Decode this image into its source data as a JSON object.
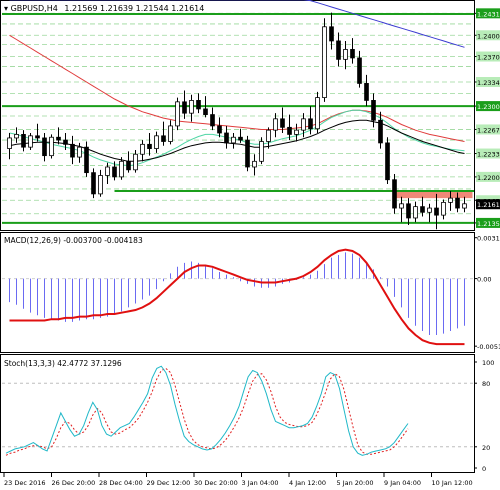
{
  "header": {
    "symbol": "GBPUSD,H4",
    "ohlc": "1.21569 1.21639 1.21544 1.21614"
  },
  "colors": {
    "grid": "#c8c8c8",
    "bull": "#000000",
    "bear": "#000000",
    "candle_fill_bull": "#ffffff",
    "ma_fast": "#4fd6a5",
    "ma_mid": "#000000",
    "ma_slow": "#e03c3c",
    "ma_trend": "#3a3ad0",
    "level_line": "#1a9e1a",
    "level_label_bg": "#7ddc7d",
    "zone_fill": "#f08878",
    "price_label_bg": "#000000",
    "macd_hist": "#6a6af2",
    "macd_signal": "#e01010",
    "stoch_main": "#20b8c8",
    "stoch_signal": "#e02020"
  },
  "chart_data": [
    {
      "panel": "price",
      "type": "candlestick",
      "ylim": [
        1.2125,
        1.2447
      ],
      "ticks": [
        "1.24310",
        "1.24000",
        "1.23700",
        "1.23340",
        "1.23000",
        "1.22670",
        "1.22330",
        "1.22000",
        "1.21670",
        "1.21350"
      ],
      "ticks_v": [
        1.2431,
        1.24,
        1.237,
        1.2334,
        1.23,
        1.2267,
        1.2233,
        1.22,
        1.2167,
        1.2135
      ],
      "hidden_ticks_v": [
        1.2416,
        1.2387,
        1.2356,
        1.2318,
        1.2286,
        1.2252,
        1.2216,
        1.2183,
        1.2148
      ],
      "levels": [
        {
          "label": "1.24300",
          "value": 1.243,
          "style": "solid"
        },
        {
          "label": "1.23000",
          "value": 1.23,
          "style": "solid"
        },
        {
          "label": "1.21800",
          "value": 1.218,
          "style": "solid"
        },
        {
          "label": "1.21350",
          "value": 1.2135,
          "style": "solid"
        }
      ],
      "current_price": {
        "label": "1.21614",
        "value": 1.21614
      },
      "zone": {
        "from": 1.217,
        "to": 1.218
      },
      "candles": [
        [
          1.224,
          1.2262,
          1.2225,
          1.2255
        ],
        [
          1.2255,
          1.227,
          1.2248,
          1.226
        ],
        [
          1.226,
          1.2266,
          1.2236,
          1.2242
        ],
        [
          1.2242,
          1.2262,
          1.2238,
          1.2258
        ],
        [
          1.2258,
          1.2275,
          1.225,
          1.2255
        ],
        [
          1.2255,
          1.2262,
          1.2222,
          1.223
        ],
        [
          1.223,
          1.226,
          1.2226,
          1.2256
        ],
        [
          1.2256,
          1.227,
          1.2246,
          1.2252
        ],
        [
          1.2252,
          1.2262,
          1.2238,
          1.2246
        ],
        [
          1.2246,
          1.2258,
          1.2218,
          1.2228
        ],
        [
          1.2228,
          1.2248,
          1.222,
          1.2242
        ],
        [
          1.2242,
          1.225,
          1.22,
          1.2206
        ],
        [
          1.2206,
          1.2212,
          1.217,
          1.2176
        ],
        [
          1.2176,
          1.221,
          1.2172,
          1.2202
        ],
        [
          1.2202,
          1.222,
          1.219,
          1.2214
        ],
        [
          1.2214,
          1.2222,
          1.2195,
          1.22
        ],
        [
          1.22,
          1.2228,
          1.2196,
          1.2222
        ],
        [
          1.2222,
          1.2236,
          1.2206,
          1.221
        ],
        [
          1.221,
          1.2238,
          1.2206,
          1.2232
        ],
        [
          1.2232,
          1.2252,
          1.2222,
          1.2246
        ],
        [
          1.2246,
          1.2262,
          1.223,
          1.224
        ],
        [
          1.224,
          1.2264,
          1.2234,
          1.2258
        ],
        [
          1.2258,
          1.2278,
          1.2244,
          1.225
        ],
        [
          1.225,
          1.228,
          1.2246,
          1.2272
        ],
        [
          1.2272,
          1.2312,
          1.2266,
          1.2306
        ],
        [
          1.2306,
          1.2322,
          1.2282,
          1.229
        ],
        [
          1.229,
          1.2316,
          1.2278,
          1.2308
        ],
        [
          1.2308,
          1.2318,
          1.229,
          1.2296
        ],
        [
          1.2296,
          1.2314,
          1.2284,
          1.2288
        ],
        [
          1.2288,
          1.2298,
          1.2266,
          1.2272
        ],
        [
          1.2272,
          1.2284,
          1.2256,
          1.2262
        ],
        [
          1.2262,
          1.2272,
          1.224,
          1.2248
        ],
        [
          1.2248,
          1.2262,
          1.224,
          1.2256
        ],
        [
          1.2256,
          1.2268,
          1.2248,
          1.2252
        ],
        [
          1.2252,
          1.2258,
          1.2208,
          1.2214
        ],
        [
          1.2214,
          1.2232,
          1.2202,
          1.2222
        ],
        [
          1.2222,
          1.2256,
          1.2218,
          1.225
        ],
        [
          1.225,
          1.227,
          1.224,
          1.2266
        ],
        [
          1.2266,
          1.229,
          1.2256,
          1.2282
        ],
        [
          1.2282,
          1.2298,
          1.2262,
          1.227
        ],
        [
          1.227,
          1.2288,
          1.2252,
          1.226
        ],
        [
          1.226,
          1.2275,
          1.225,
          1.2266
        ],
        [
          1.2266,
          1.229,
          1.2256,
          1.2282
        ],
        [
          1.2282,
          1.23,
          1.226,
          1.2268
        ],
        [
          1.2268,
          1.232,
          1.2262,
          1.2312
        ],
        [
          1.2312,
          1.2424,
          1.2306,
          1.2412
        ],
        [
          1.2412,
          1.2432,
          1.238,
          1.2392
        ],
        [
          1.2392,
          1.2404,
          1.2356,
          1.2366
        ],
        [
          1.2366,
          1.2392,
          1.2352,
          1.238
        ],
        [
          1.238,
          1.2396,
          1.236,
          1.2368
        ],
        [
          1.2368,
          1.2378,
          1.2326,
          1.2332
        ],
        [
          1.2332,
          1.2344,
          1.23,
          1.2308
        ],
        [
          1.2308,
          1.2318,
          1.227,
          1.228
        ],
        [
          1.228,
          1.2292,
          1.224,
          1.2248
        ],
        [
          1.2248,
          1.2256,
          1.219,
          1.2196
        ],
        [
          1.2196,
          1.2204,
          1.2148,
          1.2156
        ],
        [
          1.2156,
          1.2172,
          1.2136,
          1.2162
        ],
        [
          1.2162,
          1.217,
          1.2132,
          1.2142
        ],
        [
          1.2142,
          1.2165,
          1.2136,
          1.2158
        ],
        [
          1.2158,
          1.2172,
          1.2144,
          1.215
        ],
        [
          1.215,
          1.2162,
          1.2136,
          1.2156
        ],
        [
          1.2156,
          1.2176,
          1.2126,
          1.2146
        ],
        [
          1.2146,
          1.2168,
          1.214,
          1.2164
        ],
        [
          1.2164,
          1.218,
          1.2152,
          1.217
        ],
        [
          1.217,
          1.2178,
          1.215,
          1.2156
        ],
        [
          1.2156,
          1.2172,
          1.215,
          1.2162
        ]
      ],
      "ma_fast": [
        1.2262,
        1.226,
        1.2257,
        1.2254,
        1.2252,
        1.2249,
        1.2246,
        1.2244,
        1.2242,
        1.224,
        1.2237,
        1.2233,
        1.2228,
        1.2224,
        1.2221,
        1.2218,
        1.2217,
        1.2216,
        1.2217,
        1.222,
        1.2224,
        1.2228,
        1.2232,
        1.2237,
        1.2242,
        1.2248,
        1.2253,
        1.2257,
        1.226,
        1.226,
        1.2258,
        1.2256,
        1.2254,
        1.2252,
        1.2248,
        1.2246,
        1.2246,
        1.2248,
        1.2251,
        1.2254,
        1.2256,
        1.2258,
        1.2262,
        1.2266,
        1.2271,
        1.2278,
        1.2284,
        1.2288,
        1.2292,
        1.2294,
        1.2294,
        1.2292,
        1.2288,
        1.2283,
        1.2276,
        1.2268,
        1.2262,
        1.2256,
        1.2252,
        1.2248,
        1.2245,
        1.2243,
        1.2241,
        1.2239,
        1.2238,
        1.2237
      ],
      "ma_mid": [
        1.2244,
        1.2246,
        1.2247,
        1.2248,
        1.2249,
        1.2249,
        1.2249,
        1.2248,
        1.2247,
        1.2245,
        1.2243,
        1.224,
        1.2236,
        1.2232,
        1.2229,
        1.2226,
        1.2224,
        1.2222,
        1.2222,
        1.2223,
        1.2225,
        1.2227,
        1.223,
        1.2233,
        1.2237,
        1.2241,
        1.2244,
        1.2246,
        1.2248,
        1.2249,
        1.2249,
        1.2248,
        1.2247,
        1.2246,
        1.2244,
        1.2242,
        1.2242,
        1.2243,
        1.2245,
        1.2247,
        1.2249,
        1.2251,
        1.2254,
        1.2257,
        1.2261,
        1.2266,
        1.227,
        1.2274,
        1.2277,
        1.2279,
        1.228,
        1.228,
        1.2278,
        1.2276,
        1.2272,
        1.2267,
        1.2262,
        1.2258,
        1.2254,
        1.225,
        1.2247,
        1.2244,
        1.2241,
        1.2238,
        1.2235,
        1.2233
      ],
      "ma_slow": [
        1.24,
        1.2394,
        1.2388,
        1.2382,
        1.2376,
        1.237,
        1.2364,
        1.2358,
        1.2352,
        1.2346,
        1.234,
        1.2334,
        1.2328,
        1.2322,
        1.2316,
        1.231,
        1.2305,
        1.23,
        1.2296,
        1.2292,
        1.2289,
        1.2286,
        1.2283,
        1.2281,
        1.2279,
        1.2278,
        1.2277,
        1.2276,
        1.2275,
        1.2274,
        1.2273,
        1.2272,
        1.2271,
        1.227,
        1.2269,
        1.2268,
        1.2267,
        1.2267,
        1.2267,
        1.2267,
        1.2268,
        1.2269,
        1.227,
        1.2272,
        1.2275,
        1.228,
        1.2285,
        1.2289,
        1.2292,
        1.2294,
        1.2294,
        1.2293,
        1.2291,
        1.2288,
        1.2284,
        1.2279,
        1.2274,
        1.227,
        1.2266,
        1.2263,
        1.226,
        1.2258,
        1.2256,
        1.2254,
        1.2252,
        1.225
      ],
      "ma_trend": [
        1.245,
        1.245,
        1.245,
        1.245,
        1.245,
        1.245,
        1.245,
        1.245,
        1.245,
        1.245,
        1.245,
        1.245,
        1.245,
        1.245,
        1.245,
        1.245,
        1.245,
        1.245,
        1.245,
        1.245,
        1.245,
        1.245,
        1.245,
        1.245,
        1.245,
        1.245,
        1.245,
        1.245,
        1.245,
        1.245,
        1.245,
        1.245,
        1.245,
        1.245,
        1.245,
        1.245,
        1.245,
        1.245,
        1.245,
        1.245,
        1.245,
        1.245,
        1.245,
        1.2449,
        1.2446,
        1.2443,
        1.244,
        1.2437,
        1.2434,
        1.2431,
        1.2428,
        1.2425,
        1.2422,
        1.2419,
        1.2416,
        1.2413,
        1.241,
        1.2407,
        1.2404,
        1.2401,
        1.2398,
        1.2395,
        1.2392,
        1.2389,
        1.2386,
        1.2383
      ]
    },
    {
      "panel": "macd",
      "type": "histogram+line",
      "title": "MACD(12,26,9) -0.003700 -0.004183",
      "ylim": [
        -0.0056,
        0.0034
      ],
      "ticks": [
        "0.003118",
        "0.00",
        "-0.005155"
      ],
      "ticks_v": [
        0.003118,
        0.0,
        -0.005155
      ],
      "hist": [
        -0.0018,
        -0.002,
        -0.0023,
        -0.0026,
        -0.0028,
        -0.003,
        -0.0031,
        -0.0032,
        -0.0033,
        -0.0033,
        -0.0032,
        -0.0031,
        -0.0031,
        -0.003,
        -0.0029,
        -0.0027,
        -0.0025,
        -0.0022,
        -0.0019,
        -0.0016,
        -0.0013,
        -0.0008,
        -0.0002,
        0.0004,
        0.0009,
        0.0012,
        0.0013,
        0.0012,
        0.001,
        0.0008,
        0.0005,
        0.0003,
        0.0001,
        -0.0002,
        -0.0004,
        -0.0006,
        -0.0007,
        -0.0007,
        -0.0006,
        -0.0004,
        -0.0003,
        -0.0001,
        0.0001,
        0.0003,
        0.0006,
        0.0011,
        0.0016,
        0.0018,
        0.002,
        0.0019,
        0.0016,
        0.0012,
        0.0007,
        0.0001,
        -0.0006,
        -0.0014,
        -0.0022,
        -0.003,
        -0.0036,
        -0.004,
        -0.0043,
        -0.0043,
        -0.0042,
        -0.004,
        -0.0038,
        -0.0036
      ],
      "signal": [
        -0.0032,
        -0.0032,
        -0.0032,
        -0.0032,
        -0.0032,
        -0.0032,
        -0.0031,
        -0.0031,
        -0.003,
        -0.003,
        -0.0029,
        -0.0029,
        -0.0028,
        -0.0028,
        -0.0027,
        -0.0027,
        -0.0026,
        -0.0025,
        -0.0024,
        -0.0022,
        -0.0019,
        -0.0015,
        -0.001,
        -0.0005,
        0.0,
        0.0005,
        0.0008,
        0.001,
        0.001,
        0.0009,
        0.0007,
        0.0005,
        0.0003,
        0.0001,
        -0.0001,
        -0.0002,
        -0.0003,
        -0.0003,
        -0.0003,
        -0.0002,
        -0.0001,
        0.0,
        0.0002,
        0.0005,
        0.0009,
        0.0014,
        0.0018,
        0.0021,
        0.0022,
        0.0021,
        0.0018,
        0.0012,
        0.0004,
        -0.0005,
        -0.0014,
        -0.0023,
        -0.0031,
        -0.0038,
        -0.0043,
        -0.0047,
        -0.0049,
        -0.005,
        -0.005,
        -0.005,
        -0.005,
        -0.005
      ]
    },
    {
      "panel": "stoch",
      "type": "line",
      "title": "Stoch(13,3,3) 42.4772 37.1296",
      "ylim": [
        0,
        100
      ],
      "ticks": [
        "100",
        "80",
        "20",
        "0"
      ],
      "ticks_v": [
        100,
        80,
        20,
        0
      ],
      "levels": [
        80,
        20
      ],
      "main": [
        14,
        16,
        18,
        19,
        20,
        22,
        24,
        21,
        18,
        16,
        28,
        40,
        52,
        44,
        36,
        30,
        32,
        40,
        52,
        62,
        55,
        40,
        32,
        30,
        34,
        38,
        40,
        42,
        48,
        55,
        62,
        70,
        85,
        94,
        96,
        90,
        78,
        60,
        44,
        30,
        25,
        22,
        20,
        18,
        17,
        18,
        22,
        27,
        33,
        40,
        48,
        58,
        72,
        86,
        92,
        90,
        82,
        70,
        55,
        44,
        42,
        40,
        38,
        38,
        39,
        40,
        42,
        48,
        58,
        70,
        86,
        90,
        88,
        75,
        55,
        35,
        20,
        14,
        12,
        13,
        15,
        16,
        17,
        18,
        20,
        24,
        30,
        36,
        42
      ],
      "signal": [
        12,
        14,
        15,
        17,
        18,
        20,
        21,
        21,
        20,
        18,
        20,
        28,
        38,
        44,
        42,
        36,
        32,
        34,
        40,
        50,
        56,
        52,
        42,
        34,
        32,
        33,
        36,
        38,
        42,
        47,
        54,
        62,
        72,
        84,
        92,
        94,
        90,
        78,
        62,
        46,
        34,
        26,
        22,
        20,
        19,
        18,
        19,
        22,
        26,
        32,
        39,
        47,
        57,
        70,
        82,
        88,
        89,
        83,
        72,
        58,
        48,
        43,
        41,
        40,
        39,
        39,
        40,
        43,
        50,
        60,
        72,
        84,
        89,
        86,
        74,
        56,
        38,
        22,
        15,
        13,
        13,
        14,
        15,
        16,
        17,
        20,
        25,
        31,
        37
      ]
    }
  ],
  "x_axis": {
    "labels": [
      "23 Dec 2016",
      "26 Dec 20:00",
      "28 Dec 04:00",
      "29 Dec 12:00",
      "30 Dec 20:00",
      "3 Jan 04:00",
      "4 Jan 12:00",
      "5 Jan 20:00",
      "9 Jan 04:00",
      "10 Jan 12:00"
    ]
  }
}
